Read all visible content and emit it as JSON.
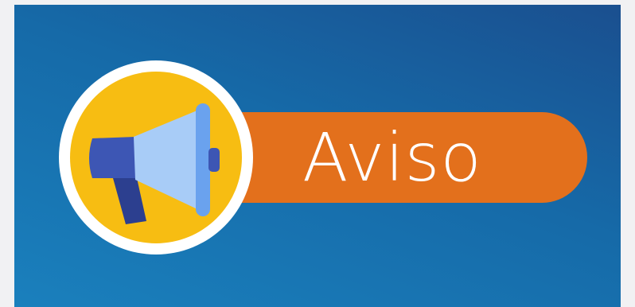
{
  "banner": {
    "label": "Aviso",
    "icon": "megaphone-icon",
    "colors": {
      "background_top": "#1a4f8f",
      "background_bottom": "#1a80bd",
      "label_pill": "#e3701c",
      "badge_circle": "#f7bd12",
      "badge_ring": "#ffffff",
      "megaphone_body": "#a8ccf7",
      "megaphone_rim": "#6aa2ee",
      "megaphone_handle": "#3a52a8"
    }
  }
}
